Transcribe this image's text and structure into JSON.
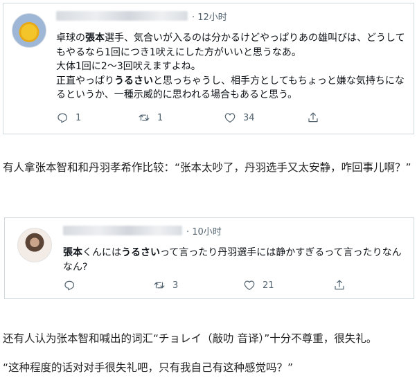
{
  "tweets": [
    {
      "time": "12小时",
      "text_parts": [
        "卓球の",
        "張本",
        "選手、気合いが入るのは分かるけどやっぱりあの雄叫びは、どうしてもやるなら1回につき1吠えにした方がいいと思うなあ。\n大体1回に2～3回吠えますよね。\n正直やっぱり",
        "うるさい",
        "と思っちゃうし、相手方としてもちょっと嫌な気持ちになるというか、一種示威的に思われる場合もあると思う。"
      ],
      "replies": "1",
      "retweets": "1",
      "likes": "34"
    },
    {
      "time": "10小时",
      "text_parts": [
        "張本",
        "くんには",
        "うるさい",
        "って言ったり丹羽選手には静かすぎるって言ったりなんなん?"
      ],
      "replies": "",
      "retweets": "3",
      "likes": "21"
    }
  ],
  "article": {
    "para1": "有人拿张本智和和丹羽孝希作比较：“张本太吵了，丹羽选手又太安静，咋回事儿啊？”",
    "para2": "还有人认为张本智和喊出的词汇“チョレイ（敲叻 音译）”十分不尊重，很失礼。",
    "para3": "“这种程度的话对对手很失礼吧，只有我自己有这种感觉吗？”"
  },
  "icons": {
    "reply": "reply-icon",
    "retweet": "retweet-icon",
    "like": "heart-icon",
    "share": "share-icon"
  },
  "colors": {
    "text": "#0f1419",
    "muted": "#536471",
    "border": "#cfd9de"
  }
}
